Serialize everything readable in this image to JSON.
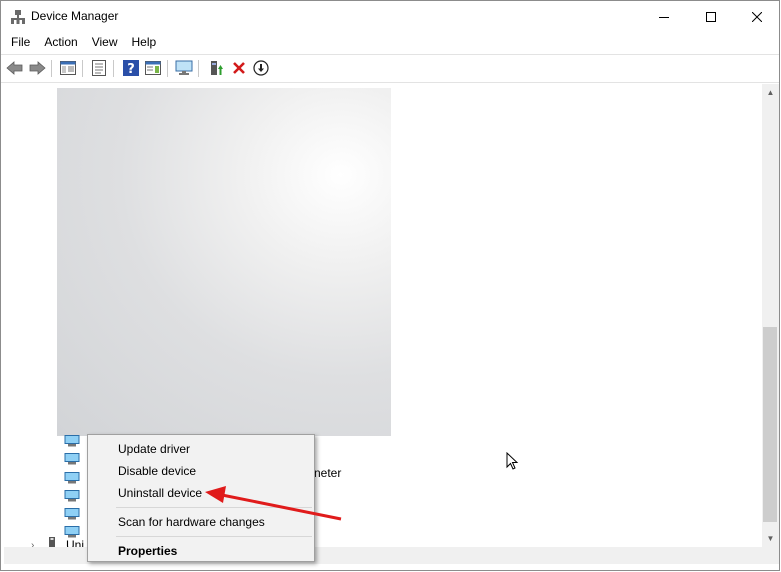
{
  "window": {
    "title": "Device Manager"
  },
  "menubar": {
    "items": [
      "File",
      "Action",
      "View",
      "Help"
    ]
  },
  "toolbar": {
    "buttons": [
      "back-icon",
      "forward-icon",
      "show-hide-console-tree-icon",
      "properties-icon",
      "help-icon",
      "action-pane-icon",
      "monitor-icon",
      "update-driver-icon",
      "uninstall-icon",
      "disable-icon"
    ]
  },
  "tree": {
    "partial_text_right": "neter",
    "partial_text_bottom": "Uni"
  },
  "context_menu": {
    "update_driver": "Update driver",
    "disable_device": "Disable device",
    "uninstall_device": "Uninstall device",
    "scan": "Scan for hardware changes",
    "properties": "Properties"
  },
  "annotation": {
    "arrow_color": "#e01b1b",
    "points_to": "Uninstall device"
  },
  "colors": {
    "close_hover": "#e81123",
    "accent": "#0078d7"
  }
}
